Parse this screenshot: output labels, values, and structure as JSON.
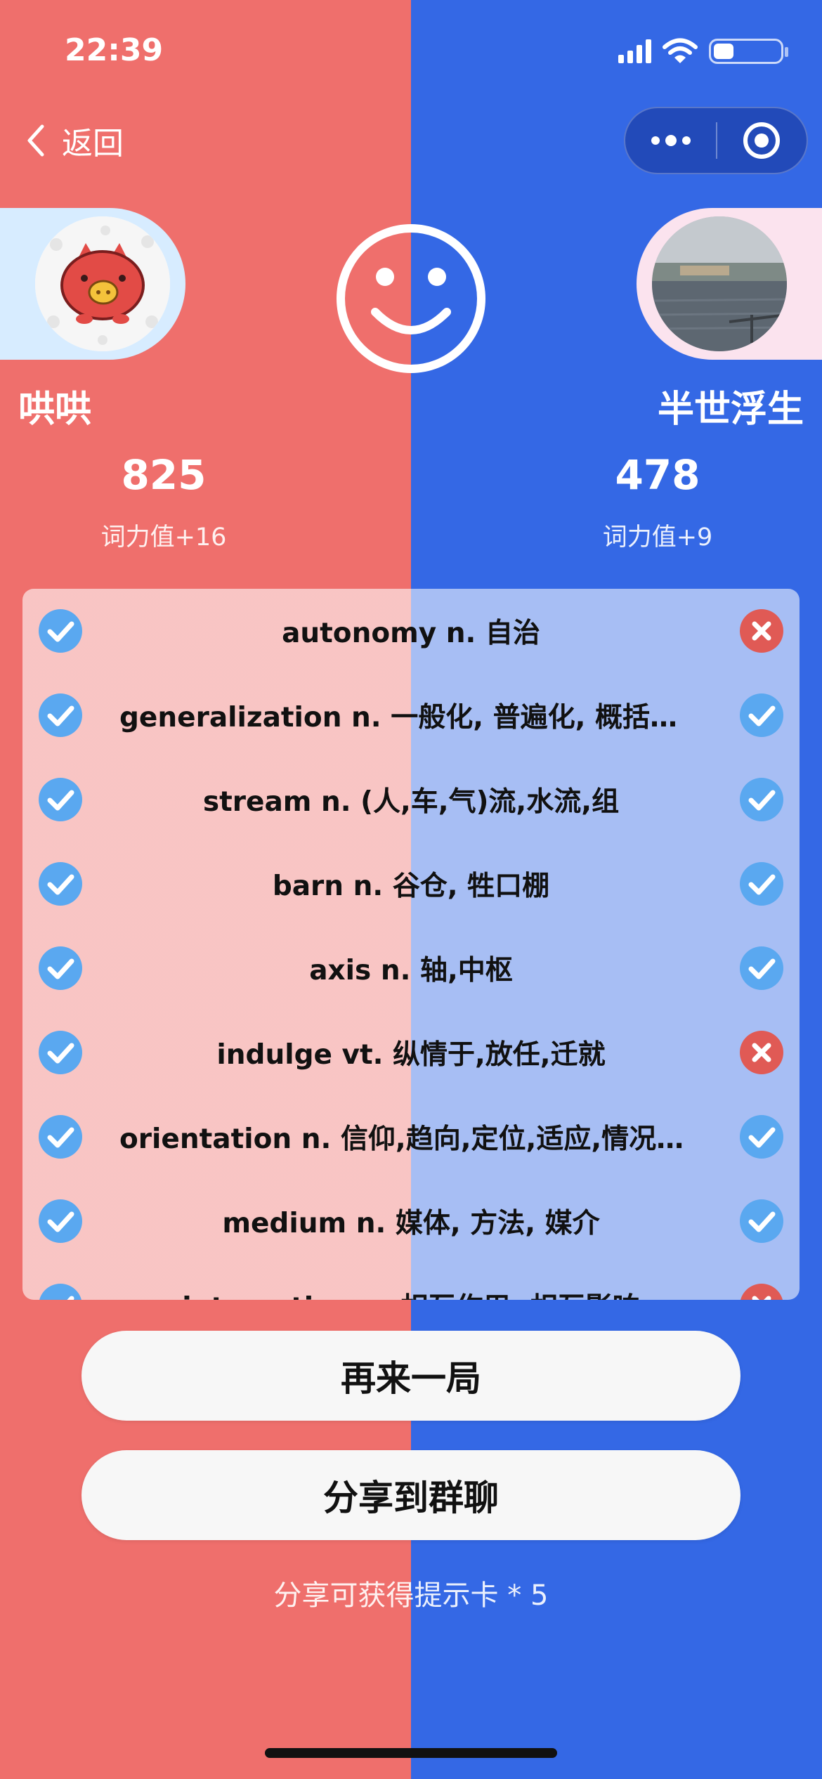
{
  "status_bar": {
    "time": "22:39",
    "battery_percent": 30
  },
  "nav": {
    "back_label": "返回"
  },
  "colors": {
    "left_team": "#ef6f6c",
    "right_team": "#3468e5",
    "correct": "#5aa8f0",
    "wrong": "#e05a55"
  },
  "players": {
    "left": {
      "name": "哄哄",
      "score": "825",
      "gain": "词力值+16",
      "avatar": "pig-avatar"
    },
    "right": {
      "name": "半世浮生",
      "score": "478",
      "gain": "词力值+9",
      "avatar": "lake-photo-avatar"
    }
  },
  "words": [
    {
      "text": "autonomy n. 自治",
      "left": "correct",
      "right": "wrong"
    },
    {
      "text": "generalization n. 一般化, 普遍化, 概括，...",
      "left": "correct",
      "right": "correct"
    },
    {
      "text": "stream n. (人,车,气)流,水流,组",
      "left": "correct",
      "right": "correct"
    },
    {
      "text": "barn n. 谷仓, 牲口棚",
      "left": "correct",
      "right": "correct"
    },
    {
      "text": "axis n. 轴,中枢",
      "left": "correct",
      "right": "correct"
    },
    {
      "text": "indulge vt. 纵情于,放任,迁就",
      "left": "correct",
      "right": "wrong"
    },
    {
      "text": "orientation n. 信仰,趋向,定位,适应,情况介绍",
      "left": "correct",
      "right": "correct"
    },
    {
      "text": "medium n. 媒体, 方法, 媒介",
      "left": "correct",
      "right": "correct"
    },
    {
      "text": "interaction n. 相互作用, 相互影响",
      "left": "correct",
      "right": "wrong"
    }
  ],
  "buttons": {
    "again": "再来一局",
    "share": "分享到群聊"
  },
  "hint": "分享可获得提示卡 * 5"
}
